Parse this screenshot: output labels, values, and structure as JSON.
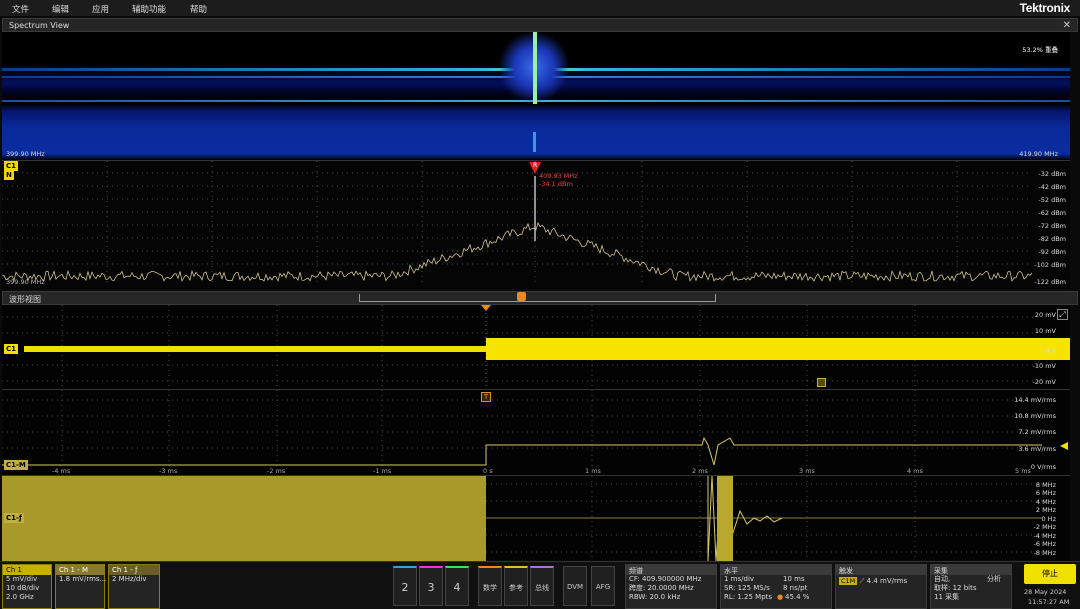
{
  "menu": {
    "file": "文件",
    "edit": "编辑",
    "apps": "应用",
    "assist": "辅助功能",
    "help": "帮助",
    "logo": "Tektronix"
  },
  "spectrum": {
    "title": "Spectrum View",
    "close": "✕",
    "overlap": "53.2% 重叠",
    "f_start": "399.90 MHz",
    "f_stop": "419.90 MHz",
    "marker_freq": "409.93 MHz",
    "marker_level": "-34.1 dBm",
    "marker_label": "R",
    "ch_tag": "C1",
    "n_tag": "N",
    "dbm": [
      "-32 dBm",
      "-42 dBm",
      "-52 dBm",
      "-62 dBm",
      "-72 dBm",
      "-82 dBm",
      "-92 dBm",
      "-102 dBm"
    ],
    "bottom_left": "399.90 MHz",
    "bottom_right": "-122 dBm"
  },
  "waveform": {
    "title": "波形视图",
    "trigger": "T",
    "ch1": {
      "tag": "C1",
      "scale": [
        "20 mV",
        "10 mV",
        "0 V",
        "-10 mV",
        "-20 mV"
      ]
    },
    "ch1m": {
      "tag": "C1-M",
      "scale": [
        "14.4 mV/rms",
        "10.8 mV/rms",
        "7.2 mV/rms",
        "3.6 mV/rms",
        "0 V/rms"
      ]
    },
    "ch1f": {
      "tag": "C1-ƒ",
      "scale": [
        "8 MHz",
        "6 MHz",
        "4 MHz",
        "2 MHz",
        "0 Hz",
        "-2 MHz",
        "-4 MHz",
        "-6 MHz",
        "-8 MHz"
      ]
    },
    "time": [
      "-4 ms",
      "-3 ms",
      "-2 ms",
      "-1 ms",
      "0 s",
      "1 ms",
      "2 ms",
      "3 ms",
      "4 ms",
      "5 ms"
    ]
  },
  "badges": {
    "ch1": {
      "title": "Ch 1",
      "l1": "5 mV/div",
      "l2": "10 dB/div",
      "l3": "2.0 GHz"
    },
    "ch1m": {
      "title": "Ch 1 - M",
      "l1": "1.8 mV/rms..."
    },
    "ch1f": {
      "title": "Ch 1 - ƒ",
      "l1": "2 MHz/div"
    },
    "freq": {
      "title": "频谱",
      "l1": "CF: 409.900000 MHz",
      "l2": "跨度: 20.0000 MHz",
      "l3": "RBW: 20.0 kHz"
    },
    "horiz": {
      "title": "水平",
      "l1a": "1 ms/div",
      "l1b": "10 ms",
      "l2a": "SR: 125 MS/s",
      "l2b": "8 ns/pt",
      "l3a": "RL: 1.25 Mpts",
      "l3b": "45.4 %"
    },
    "trig": {
      "title": "触发",
      "tag": "C1M",
      "val": "4.4 mV/rms"
    },
    "acq": {
      "title": "采集",
      "l1a": "自动,",
      "l1b": "分析",
      "l2": "取样: 12 bits",
      "l3": "11 采集"
    },
    "date": "28 May 2024",
    "time": "11:57:27 AM",
    "stop": "停止"
  },
  "buttons": {
    "b2": "2",
    "b3": "3",
    "b4": "4",
    "math": "数学",
    "ref": "参考",
    "bus": "总线",
    "dvm": "DVM",
    "afg": "AFG"
  }
}
